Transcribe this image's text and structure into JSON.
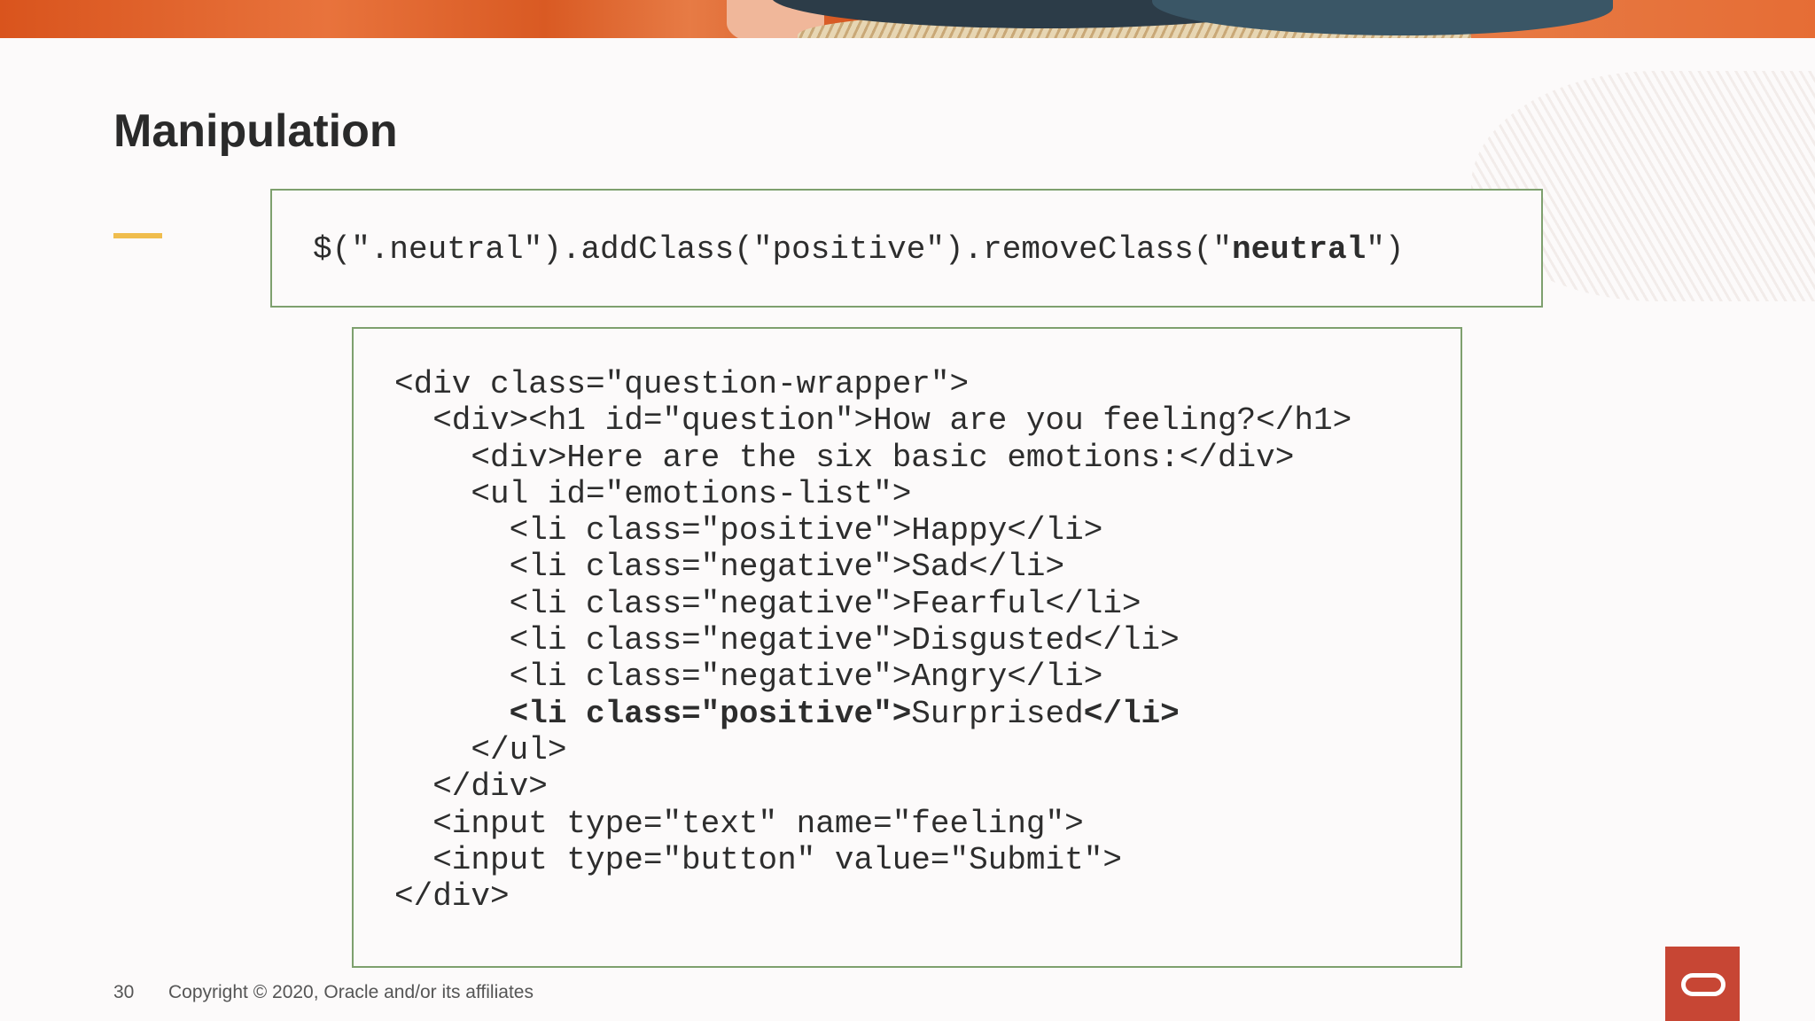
{
  "slide": {
    "title": "Manipulation",
    "page_number": "30",
    "copyright": "Copyright © 2020, Oracle and/or its affiliates"
  },
  "code_top": {
    "before": "$(\".neutral\").addClass(\"positive\").removeClass(\"",
    "bold": "neutral",
    "after": "\")"
  },
  "code_block": {
    "lines": [
      "<div class=\"question-wrapper\">",
      "  <div><h1 id=\"question\">How are you feeling?</h1>",
      "    <div>Here are the six basic emotions:</div>",
      "    <ul id=\"emotions-list\">",
      "      <li class=\"positive\">Happy</li>",
      "      <li class=\"negative\">Sad</li>",
      "      <li class=\"negative\">Fearful</li>",
      "      <li class=\"negative\">Disgusted</li>",
      "      <li class=\"negative\">Angry</li>",
      "      <li class=\"positive\">",
      "    </ul>",
      "  </div>",
      "  <input type=\"text\" name=\"feeling\">",
      "  <input type=\"button\" value=\"Submit\">",
      "</div>"
    ],
    "highlight_line": {
      "bold_start": "      <li class=\"positive\">",
      "normal": "Surprised",
      "bold_end": "</li>"
    }
  },
  "colors": {
    "accent_bar": "#f0bd4d",
    "code_border": "#7ea06e",
    "oracle_red": "#c74634"
  },
  "icons": {
    "logo": "oracle-logo-icon"
  }
}
